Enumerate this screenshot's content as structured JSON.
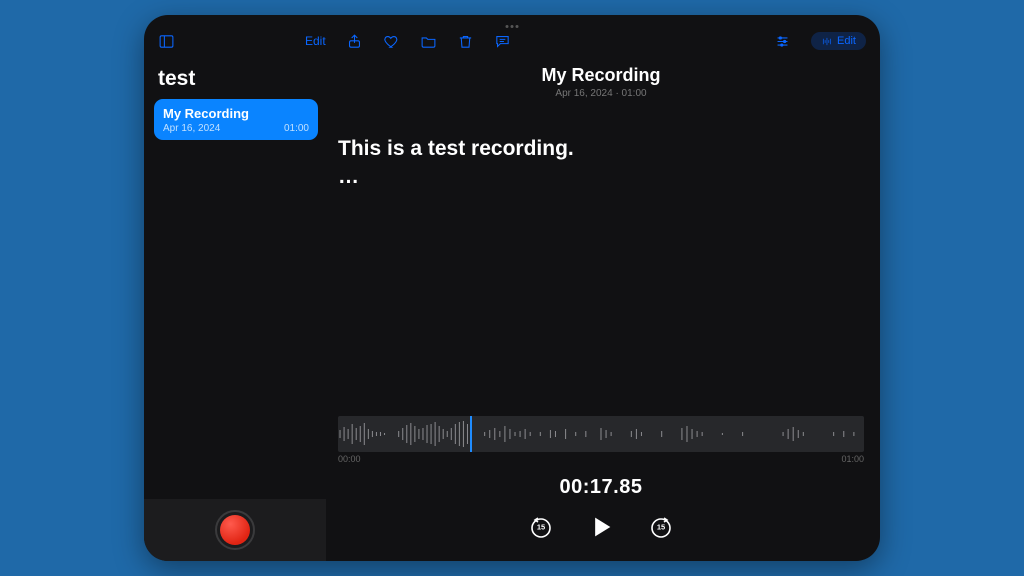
{
  "toolbar": {
    "edit_label_left": "Edit",
    "edit_label_right": "Edit"
  },
  "sidebar": {
    "title": "test",
    "items": [
      {
        "name": "My Recording",
        "date": "Apr 16, 2024",
        "duration": "01:00"
      }
    ]
  },
  "main": {
    "title": "My Recording",
    "subtitle": "Apr 16, 2024 · 01:00",
    "transcript_line1": "This is a test recording.",
    "transcript_line2": "…",
    "time_start": "00:00",
    "time_end": "01:00",
    "current_time": "00:17.85",
    "skip_seconds": "15"
  }
}
